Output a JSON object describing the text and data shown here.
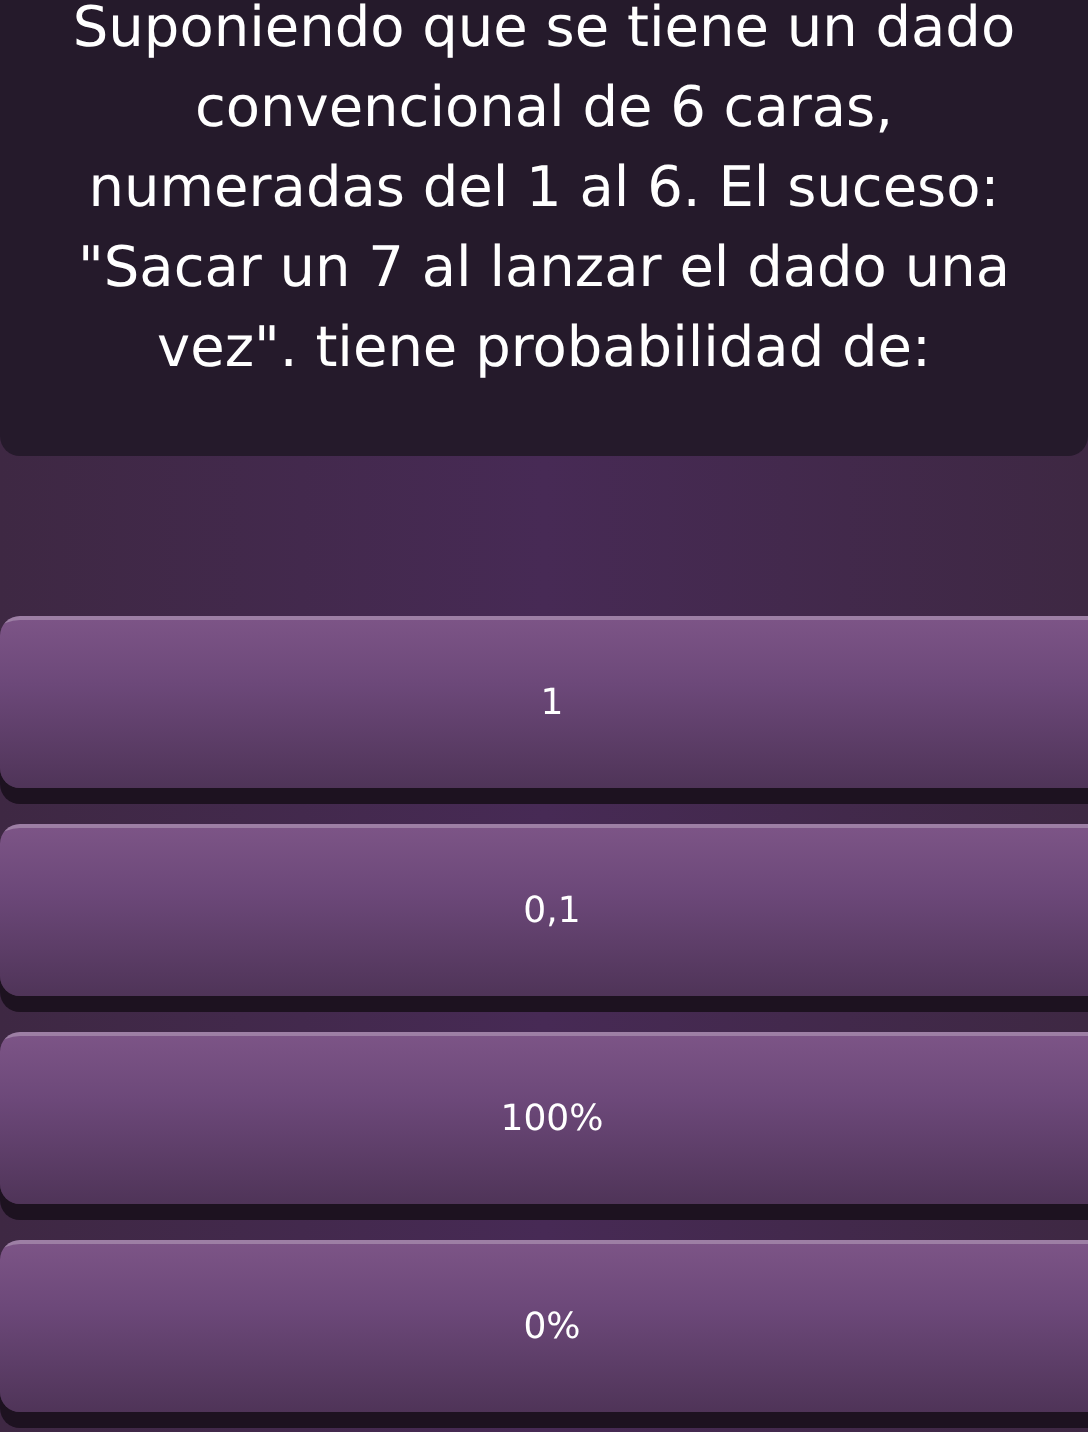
{
  "question": "Suponiendo que se tiene un dado convencional de 6 caras, numeradas del 1 al 6. El suceso: \"Sacar un 7 al lanzar el dado una vez\". tiene probabilidad de:",
  "options": [
    {
      "label": "1"
    },
    {
      "label": "0,1"
    },
    {
      "label": "100%"
    },
    {
      "label": "0%"
    }
  ]
}
